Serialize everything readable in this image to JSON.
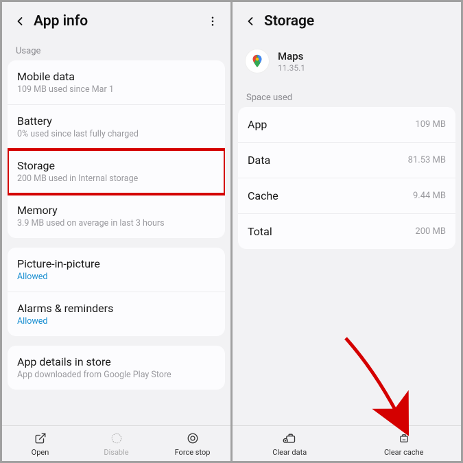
{
  "left": {
    "title": "App info",
    "usage_label": "Usage",
    "rows": {
      "mobile_data": {
        "t": "Mobile data",
        "s": "109 MB used since Mar 1"
      },
      "battery": {
        "t": "Battery",
        "s": "0% used since last fully charged"
      },
      "storage": {
        "t": "Storage",
        "s": "200 MB used in Internal storage"
      },
      "memory": {
        "t": "Memory",
        "s": "3.9 MB used on average in last 3 hours"
      },
      "pip": {
        "t": "Picture-in-picture",
        "s": "Allowed"
      },
      "alarms": {
        "t": "Alarms & reminders",
        "s": "Allowed"
      },
      "details": {
        "t": "App details in store",
        "s": "App downloaded from Google Play Store"
      }
    },
    "bottom": {
      "open": "Open",
      "disable": "Disable",
      "force_stop": "Force stop"
    }
  },
  "right": {
    "title": "Storage",
    "app": {
      "name": "Maps",
      "version": "11.35.1"
    },
    "space_label": "Space used",
    "kv": {
      "app": {
        "k": "App",
        "v": "109 MB"
      },
      "data": {
        "k": "Data",
        "v": "81.53 MB"
      },
      "cache": {
        "k": "Cache",
        "v": "9.44 MB"
      },
      "total": {
        "k": "Total",
        "v": "200 MB"
      }
    },
    "bottom": {
      "clear_data": "Clear data",
      "clear_cache": "Clear cache"
    }
  }
}
